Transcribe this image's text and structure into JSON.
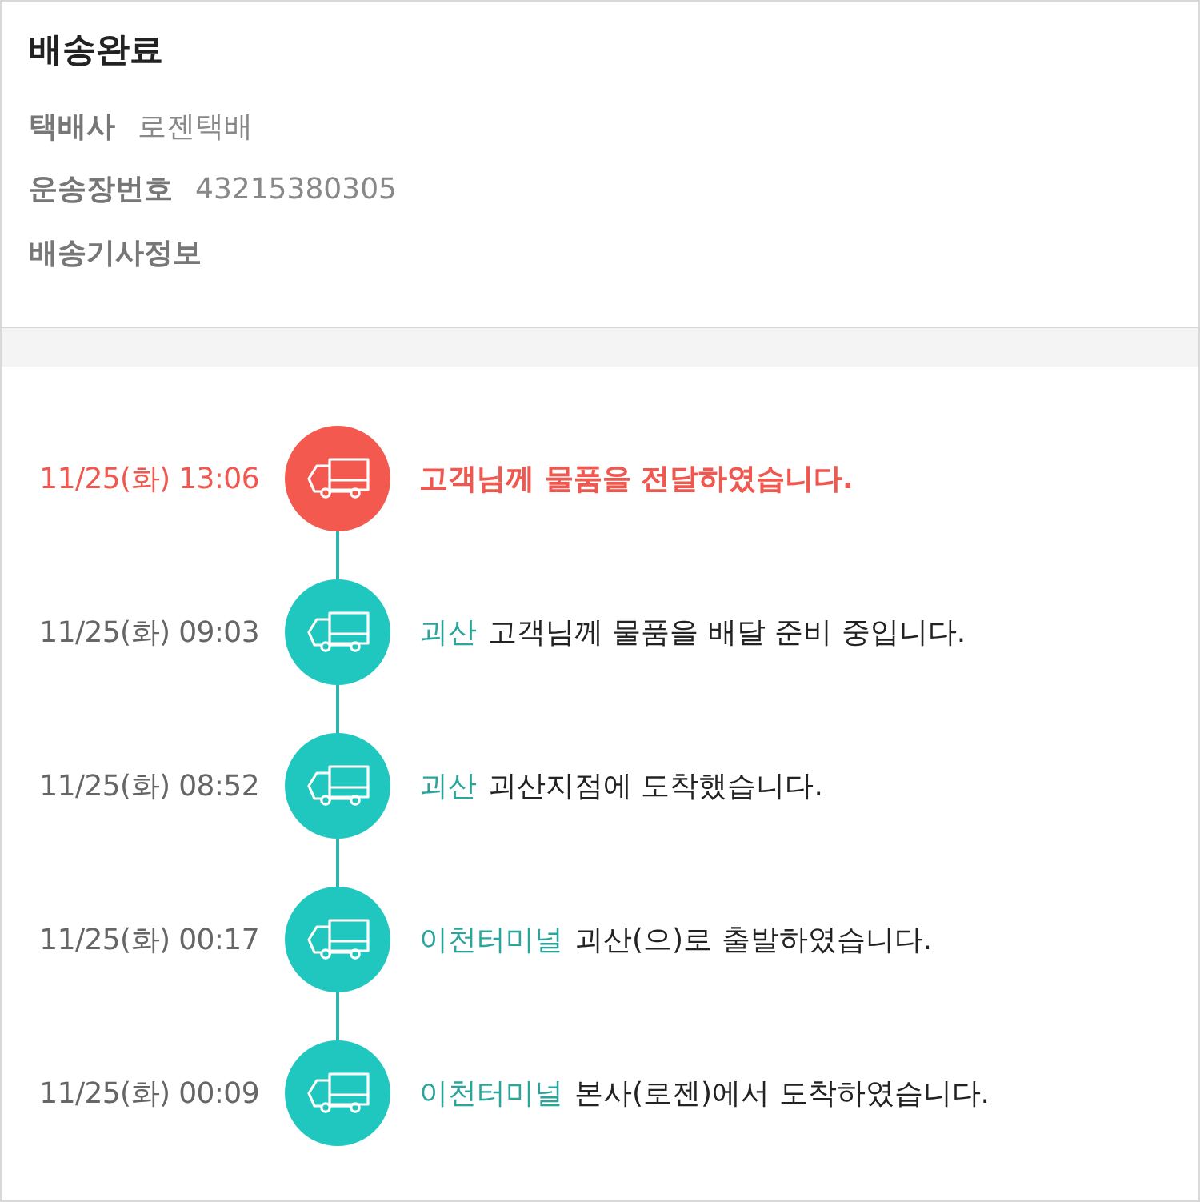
{
  "header": {
    "status": "배송완료",
    "fields": [
      {
        "label": "택배사",
        "value": "로젠택배"
      },
      {
        "label": "운송장번호",
        "value": "43215380305"
      },
      {
        "label": "배송기사정보"
      }
    ]
  },
  "timeline": [
    {
      "time": "11/25(화) 13:06",
      "message": "고객님께 물품을 전달하였습니다.",
      "current": true
    },
    {
      "time": "11/25(화) 09:03",
      "location": "괴산",
      "message": "고객님께 물품을 배달 준비 중입니다.",
      "current": false
    },
    {
      "time": "11/25(화) 08:52",
      "location": "괴산",
      "message": "괴산지점에 도착했습니다.",
      "current": false
    },
    {
      "time": "11/25(화) 00:17",
      "location": "이천터미널",
      "message": "괴산(으)로 출발하였습니다.",
      "current": false
    },
    {
      "time": "11/25(화) 00:09",
      "location": "이천터미널",
      "message": "본사(로젠)에서 도착하였습니다.",
      "current": false
    }
  ]
}
